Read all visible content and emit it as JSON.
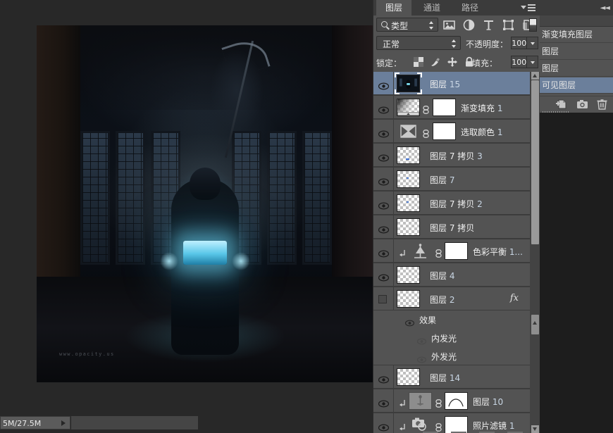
{
  "document": {
    "watermark": "www.opacity.us",
    "status_text": "5M/27.5M"
  },
  "layers_panel": {
    "tabs": [
      {
        "label": "图层",
        "active": true
      },
      {
        "label": "通道",
        "active": false
      },
      {
        "label": "路径",
        "active": false
      }
    ],
    "filter": {
      "kind_label": "类型",
      "icons": [
        "image-filter-icon",
        "adjustment-filter-icon",
        "type-filter-icon",
        "shape-filter-icon",
        "smart-object-filter-icon"
      ]
    },
    "blend_mode": "正常",
    "opacity_label": "不透明度：",
    "opacity_value": "100%",
    "lock_label": "锁定：",
    "lock_icons": [
      "lock-transparency-icon",
      "lock-image-icon",
      "lock-position-icon",
      "lock-all-icon"
    ],
    "fill_label": "填充：",
    "fill_value": "100%",
    "layers": [
      {
        "name": "图层",
        "num": "15",
        "visible": true,
        "selected": true,
        "thumb": "image",
        "kind": "pixel"
      },
      {
        "name": "渐变填充",
        "num": "1",
        "visible": true,
        "selected": false,
        "thumb": "gradient",
        "kind": "fill",
        "mask": true,
        "linked": true
      },
      {
        "name": "选取颜色",
        "num": "1",
        "visible": true,
        "selected": false,
        "thumb": "selective-color",
        "kind": "adjustment",
        "mask": true,
        "linked": true
      },
      {
        "name": "图层 7 拷贝",
        "num": "3",
        "visible": true,
        "selected": false,
        "thumb": "transparent",
        "kind": "pixel"
      },
      {
        "name": "图层",
        "num": "7",
        "visible": true,
        "selected": false,
        "thumb": "transparent",
        "kind": "pixel"
      },
      {
        "name": "图层 7 拷贝",
        "num": "2",
        "visible": true,
        "selected": false,
        "thumb": "transparent",
        "kind": "pixel"
      },
      {
        "name": "图层 7 拷贝",
        "num": "",
        "visible": true,
        "selected": false,
        "thumb": "transparent",
        "kind": "pixel"
      },
      {
        "name": "色彩平衡",
        "num": "1...",
        "visible": true,
        "selected": false,
        "thumb": "color-balance",
        "kind": "adjustment",
        "mask": true,
        "linked": true,
        "clipped": true
      },
      {
        "name": "图层",
        "num": "4",
        "visible": true,
        "selected": false,
        "thumb": "transparent",
        "kind": "pixel"
      },
      {
        "name": "图层",
        "num": "2",
        "visible": false,
        "selected": false,
        "thumb": "transparent",
        "kind": "pixel",
        "has_fx": true,
        "fx_label": "fx"
      },
      {
        "name": "图层",
        "num": "14",
        "visible": true,
        "selected": false,
        "thumb": "transparent",
        "kind": "pixel"
      },
      {
        "name": "图层",
        "num": "10",
        "visible": true,
        "selected": false,
        "thumb": "curves-adj",
        "kind": "adjustment",
        "mask": true,
        "linked": true,
        "clipped": true
      },
      {
        "name": "照片滤镜",
        "num": "1",
        "visible": true,
        "selected": false,
        "thumb": "photo-filter",
        "kind": "adjustment",
        "mask": true,
        "linked": true,
        "clipped": true
      }
    ],
    "effects_group": {
      "label": "效果",
      "items": [
        {
          "label": "内发光",
          "visible": true
        },
        {
          "label": "外发光",
          "visible": true
        }
      ]
    }
  },
  "background_panel": {
    "rows": [
      {
        "label": "渐变填充图层",
        "selected": false
      },
      {
        "label": "图层",
        "selected": false
      },
      {
        "label": "图层",
        "selected": false
      },
      {
        "label": "可见图层",
        "selected": true
      }
    ],
    "buttons": [
      "new-document-icon",
      "snapshot-camera-icon",
      "delete-trash-icon"
    ]
  }
}
